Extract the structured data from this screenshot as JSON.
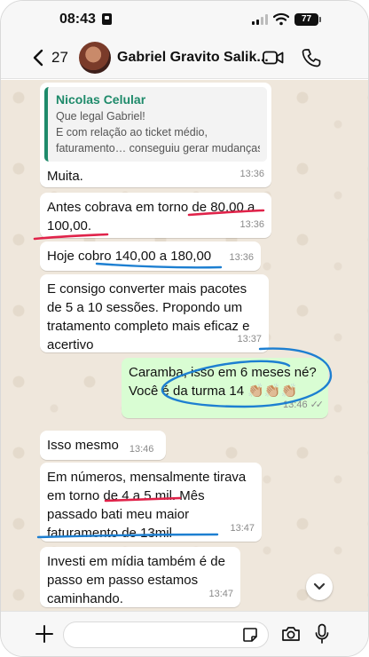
{
  "status_bar": {
    "time": "08:43",
    "battery": "77"
  },
  "header": {
    "back_count": "27",
    "contact_name": "Gabriel Gravito Salik..."
  },
  "messages": [
    {
      "quote_author": "Nicolas Celular",
      "quote_lines": [
        "Que legal Gabriel!",
        "E com relação ao ticket médio,",
        "faturamento… conseguiu gerar mudanças…"
      ],
      "text": "Muita.",
      "time": "13:36"
    },
    {
      "text_lines": [
        "Antes cobrava em torno de 80,00 a",
        "100,00."
      ],
      "time": "13:36"
    },
    {
      "text": "Hoje cobro 140,00 a 180,00",
      "time": "13:36"
    },
    {
      "text_lines": [
        "E consigo converter mais pacotes",
        "de 5 a 10 sessões. Propondo um",
        "tratamento completo mais eficaz e",
        "acertivo"
      ],
      "time": "13:37"
    },
    {
      "text_lines": [
        "Caramba, isso em 6 meses né?",
        "Você é da turma 14 👏🏼👏🏼👏🏼"
      ],
      "time": "13:46"
    },
    {
      "text": "Isso mesmo",
      "time": "13:46"
    },
    {
      "text_lines": [
        "Em números, mensalmente tirava",
        "em torno de 4 a 5 mil. Mês",
        "passado bati meu maior",
        "faturamento de 13mil"
      ],
      "time": "13:47"
    },
    {
      "text_lines": [
        "Investi em mídia também é de",
        "passo em passo estamos",
        "caminhando."
      ],
      "time": "13:47"
    }
  ],
  "colors": {
    "accent_green": "#1e8a6a",
    "outgoing_bubble": "#d9fdd3",
    "annotation_red": "#e0234a",
    "annotation_blue": "#1d7fd1"
  },
  "composer": {
    "input_value": "",
    "placeholder": ""
  }
}
